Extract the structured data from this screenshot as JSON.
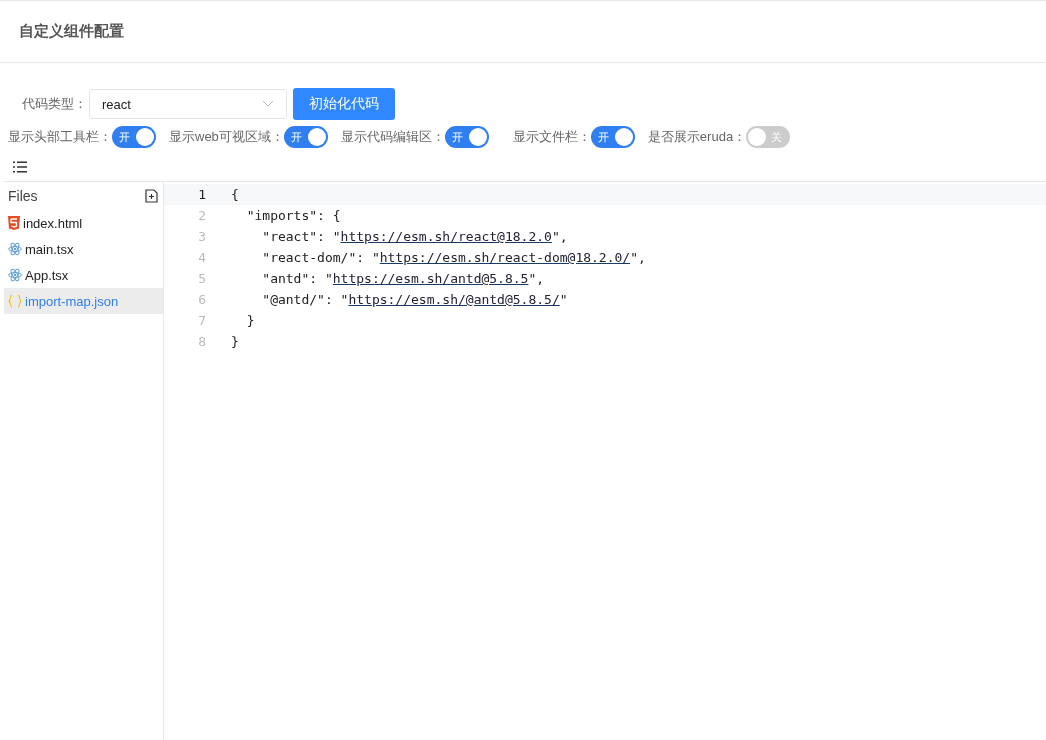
{
  "header": {
    "title": "自定义组件配置"
  },
  "code_type": {
    "label": "代码类型：",
    "value": "react"
  },
  "init_button": "初始化代码",
  "toggles": [
    {
      "label": "显示头部工具栏：",
      "on": true,
      "text": "开"
    },
    {
      "label": "显示web可视区域：",
      "on": true,
      "text": "开"
    },
    {
      "label": "显示代码编辑区：",
      "on": true,
      "text": "开"
    },
    {
      "label": "显示文件栏：",
      "on": true,
      "text": "开"
    },
    {
      "label": "是否展示eruda：",
      "on": false,
      "text": "关"
    }
  ],
  "files": {
    "title": "Files",
    "items": [
      {
        "name": "index.html",
        "kind": "html",
        "selected": false
      },
      {
        "name": "main.tsx",
        "kind": "react",
        "selected": false
      },
      {
        "name": "App.tsx",
        "kind": "react",
        "selected": false
      },
      {
        "name": "import-map.json",
        "kind": "json",
        "selected": true
      }
    ]
  },
  "editor": {
    "lines": [
      {
        "number": "1",
        "current": true,
        "before": "{"
      },
      {
        "number": "2",
        "current": false,
        "before": "  \"imports\": {"
      },
      {
        "number": "3",
        "current": false,
        "before": "    \"react\": \"",
        "link": "https://esm.sh/react@18.2.0",
        "after": "\","
      },
      {
        "number": "4",
        "current": false,
        "before": "    \"react-dom/\": \"",
        "link": "https://esm.sh/react-dom@18.2.0/",
        "after": "\","
      },
      {
        "number": "5",
        "current": false,
        "before": "    \"antd\": \"",
        "link": "https://esm.sh/antd@5.8.5",
        "after": "\","
      },
      {
        "number": "6",
        "current": false,
        "before": "    \"@antd/\": \"",
        "link": "https://esm.sh/@antd@5.8.5/",
        "after": "\""
      },
      {
        "number": "7",
        "current": false,
        "before": "  }"
      },
      {
        "number": "8",
        "current": false,
        "before": "}"
      }
    ]
  }
}
